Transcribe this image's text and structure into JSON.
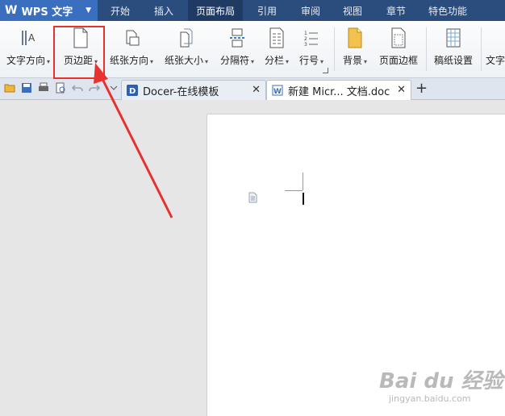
{
  "app": {
    "name": "WPS 文字"
  },
  "menu_tabs": [
    {
      "label": "开始"
    },
    {
      "label": "插入"
    },
    {
      "label": "页面布局"
    },
    {
      "label": "引用"
    },
    {
      "label": "审阅"
    },
    {
      "label": "视图"
    },
    {
      "label": "章节"
    },
    {
      "label": "特色功能"
    }
  ],
  "ribbon": {
    "buttons": [
      {
        "label": "文字方向"
      },
      {
        "label": "页边距"
      },
      {
        "label": "纸张方向"
      },
      {
        "label": "纸张大小"
      },
      {
        "label": "分隔符"
      },
      {
        "label": "分栏"
      },
      {
        "label": "行号"
      },
      {
        "label": "背景"
      },
      {
        "label": "页面边框"
      },
      {
        "label": "稿纸设置"
      },
      {
        "label": "文字"
      }
    ]
  },
  "doc_tabs": [
    {
      "label": "Docer-在线模板"
    },
    {
      "label": "新建 Micr... 文档.doc"
    }
  ],
  "new_tab_label": "+",
  "watermark": {
    "brand": "Bai du 经验",
    "url": "jingyan.baidu.com"
  },
  "colors": {
    "menubar": "#2b4d7e",
    "app_button": "#3a6fc0",
    "annotation": "#e8322f"
  }
}
